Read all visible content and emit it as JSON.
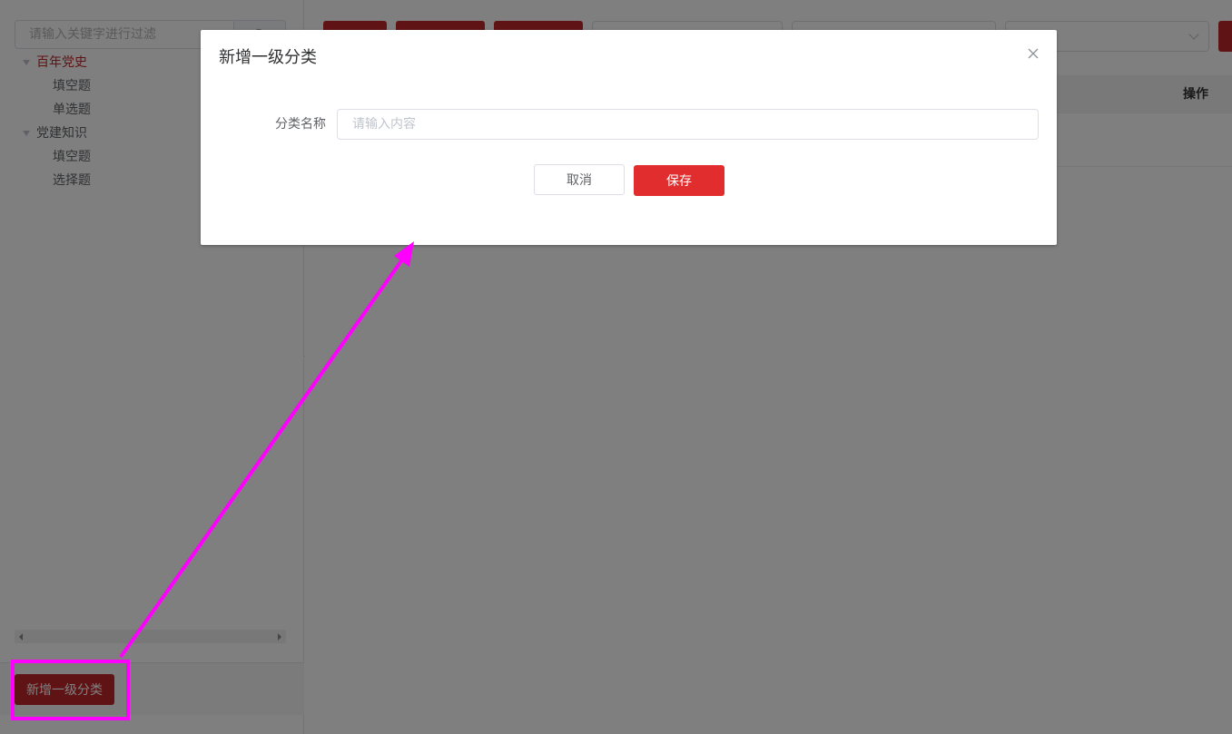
{
  "sidebar": {
    "filter_placeholder": "请输入关键字进行过滤",
    "filter_button_icon": "search-icon",
    "tree": [
      {
        "label": "百年党史",
        "active": true,
        "children": [
          "填空题",
          "单选题"
        ]
      },
      {
        "label": "党建知识",
        "active": false,
        "children": [
          "填空题",
          "选择题"
        ]
      }
    ],
    "add_category_label": "新增一级分类"
  },
  "table": {
    "ops_header": "操作"
  },
  "dialog": {
    "title": "新增一级分类",
    "close_icon": "close-icon",
    "field_label": "分类名称",
    "field_placeholder": "请输入内容",
    "field_value": "",
    "cancel_label": "取消",
    "save_label": "保存"
  },
  "colors": {
    "brand_red": "#c0262a",
    "save_red": "#e12d2d",
    "annotation_magenta": "#ff00ff",
    "overlay": "rgba(0,0,0,0.5)"
  }
}
